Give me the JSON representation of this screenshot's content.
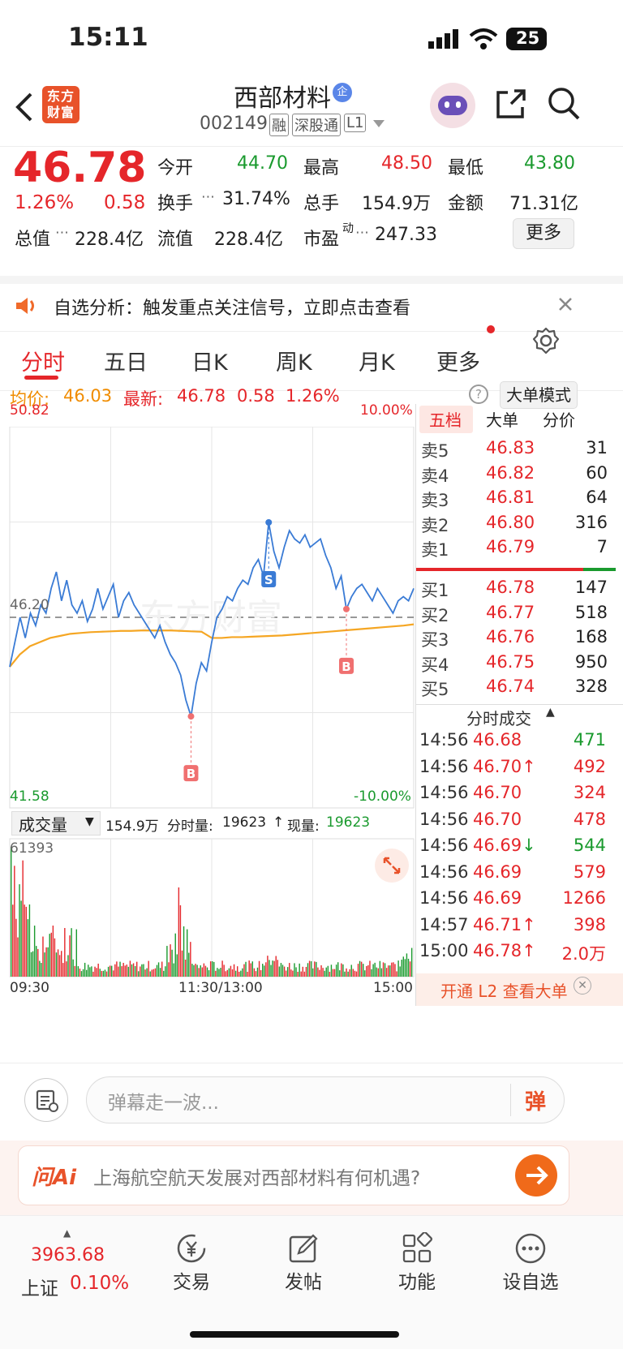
{
  "status_bar": {
    "time": "15:11",
    "battery": "25"
  },
  "header": {
    "logo_text": "东方财富",
    "stock_name": "西部材料",
    "name_badge": "企",
    "code": "002149",
    "tags": [
      "融",
      "深股通",
      "L1"
    ]
  },
  "quote": {
    "price": "46.78",
    "change_pct": "1.26%",
    "change": "0.58",
    "open_label": "今开",
    "open": "44.70",
    "high_label": "最高",
    "high": "48.50",
    "low_label": "最低",
    "low": "43.80",
    "turnover_label": "换手",
    "turnover": "31.74%",
    "volume_label": "总手",
    "volume": "154.9万",
    "amount_label": "金额",
    "amount": "71.31亿",
    "mcap_label": "总值",
    "mcap": "228.4亿",
    "float_label": "流值",
    "float_cap": "228.4亿",
    "pe_label": "市盈",
    "pe_sup": "动",
    "pe": "247.33",
    "more_label": "更多"
  },
  "notice": {
    "text": "自选分析：触发重点关注信号，立即点击查看"
  },
  "tabs": [
    "分时",
    "五日",
    "日K",
    "周K",
    "月K",
    "更多"
  ],
  "chart_info": {
    "avg_label": "均价:",
    "avg": "46.03",
    "latest_label": "最新:",
    "latest": "46.78",
    "latest_change": "0.58",
    "latest_pct": "1.26%",
    "mode_button": "大单模式"
  },
  "order_tabs": [
    "五档",
    "大单",
    "分价"
  ],
  "asks": [
    {
      "label": "卖5",
      "price": "46.83",
      "vol": "31"
    },
    {
      "label": "卖4",
      "price": "46.82",
      "vol": "60"
    },
    {
      "label": "卖3",
      "price": "46.81",
      "vol": "64"
    },
    {
      "label": "卖2",
      "price": "46.80",
      "vol": "316"
    },
    {
      "label": "卖1",
      "price": "46.79",
      "vol": "7"
    }
  ],
  "bids": [
    {
      "label": "买1",
      "price": "46.78",
      "vol": "147"
    },
    {
      "label": "买2",
      "price": "46.77",
      "vol": "518"
    },
    {
      "label": "买3",
      "price": "46.76",
      "vol": "168"
    },
    {
      "label": "买4",
      "price": "46.75",
      "vol": "950"
    },
    {
      "label": "买5",
      "price": "46.74",
      "vol": "328"
    }
  ],
  "trades_header": "分时成交",
  "trades": [
    {
      "time": "14:56",
      "price": "46.68",
      "vol": "471",
      "dir": "",
      "color": "#1a9a2e"
    },
    {
      "time": "14:56",
      "price": "46.70",
      "vol": "492",
      "dir": "↑",
      "color": "#e5262a"
    },
    {
      "time": "14:56",
      "price": "46.70",
      "vol": "324",
      "dir": "",
      "color": "#e5262a"
    },
    {
      "time": "14:56",
      "price": "46.70",
      "vol": "478",
      "dir": "",
      "color": "#e5262a"
    },
    {
      "time": "14:56",
      "price": "46.69",
      "vol": "544",
      "dir": "↓",
      "color": "#1a9a2e"
    },
    {
      "time": "14:56",
      "price": "46.69",
      "vol": "579",
      "dir": "",
      "color": "#e5262a"
    },
    {
      "time": "14:56",
      "price": "46.69",
      "vol": "1266",
      "dir": "",
      "color": "#e5262a"
    },
    {
      "time": "14:57",
      "price": "46.71",
      "vol": "398",
      "dir": "↑",
      "color": "#e5262a"
    },
    {
      "time": "15:00",
      "price": "46.78",
      "vol": "2.0万",
      "dir": "↑",
      "color": "#e5262a"
    }
  ],
  "l2_promo": "开通 L2 查看大单",
  "chart_data": {
    "type": "line",
    "y_max_label": "50.82",
    "y_min_label": "41.58",
    "y_pct_max": "10.00%",
    "y_pct_min": "-10.00%",
    "prev_close_label": "46.20",
    "prev_close": 46.2,
    "ymin": 41.58,
    "ymax": 50.82,
    "x_labels": [
      "09:30",
      "11:30/13:00",
      "15:00"
    ],
    "watermark": "东方财富",
    "price": [
      45.0,
      45.6,
      46.2,
      45.7,
      46.3,
      46.0,
      46.5,
      46.3,
      46.9,
      47.3,
      46.6,
      47.1,
      46.5,
      46.3,
      46.6,
      46.1,
      46.4,
      46.9,
      46.4,
      46.7,
      47.0,
      46.2,
      46.6,
      46.8,
      46.5,
      46.3,
      46.1,
      45.9,
      45.7,
      46.0,
      45.6,
      45.3,
      45.1,
      44.8,
      44.2,
      43.8,
      44.6,
      45.1,
      44.9,
      45.6,
      46.2,
      46.4,
      46.7,
      46.6,
      46.9,
      47.1,
      47.0,
      47.4,
      47.6,
      47.2,
      48.5,
      47.8,
      47.4,
      47.9,
      48.3,
      48.1,
      48.0,
      48.2,
      47.9,
      48.0,
      48.1,
      47.7,
      47.4,
      46.9,
      47.2,
      46.4,
      46.7,
      46.9,
      47.0,
      46.8,
      46.6,
      46.9,
      46.7,
      46.5,
      46.3,
      46.6,
      46.7,
      46.6,
      46.9
    ],
    "avg": [
      45.0,
      45.3,
      45.5,
      45.6,
      45.7,
      45.75,
      45.8,
      45.82,
      45.84,
      45.85,
      45.86,
      45.87,
      45.87,
      45.88,
      45.88,
      45.88,
      45.88,
      45.87,
      45.86,
      45.85,
      45.7,
      45.7,
      45.72,
      45.72,
      45.73,
      45.74,
      45.75,
      45.76,
      45.78,
      45.8,
      45.82,
      45.84,
      45.86,
      45.88,
      45.9,
      45.92,
      45.94,
      45.96,
      45.98,
      46.0,
      46.03
    ],
    "volume_label": "成交量",
    "volume_total": "154.9万",
    "tick_vol_label": "分时量:",
    "tick_vol": "19623",
    "cur_vol_label": "现量:",
    "cur_vol": "19623",
    "vol_max_label": "61393",
    "markers": [
      {
        "text": "S",
        "color": "#3a7bd5"
      },
      {
        "text": "B",
        "color": "#f07070"
      },
      {
        "text": "B",
        "color": "#f07070"
      }
    ]
  },
  "comment": {
    "placeholder": "弹幕走一波...",
    "danmu_label": "弹"
  },
  "ai": {
    "logo": "问Ai",
    "question": "上海航空航天发展对西部材料有何机遇?"
  },
  "bottom_nav": {
    "index_value": "3963.68",
    "index_name": "上证",
    "index_pct": "0.10%",
    "items": [
      "交易",
      "发帖",
      "功能",
      "设自选"
    ]
  },
  "colors": {
    "up": "#e5262a",
    "down": "#1a9a2e",
    "avg_line": "#f5a623",
    "price_line": "#3a7bd5"
  }
}
